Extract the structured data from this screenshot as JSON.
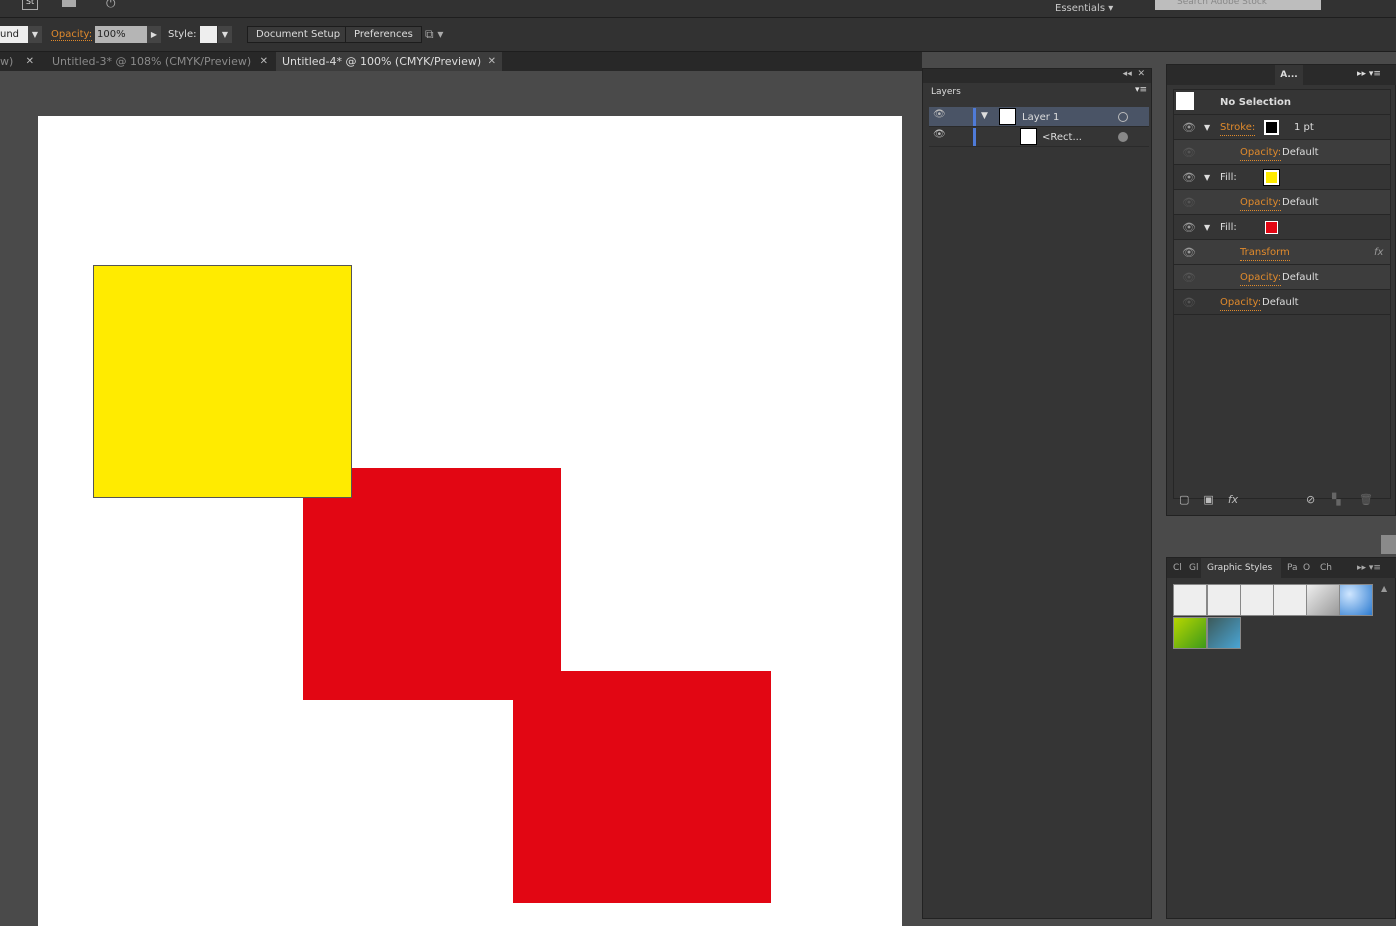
{
  "topbar": {
    "workspace": "Essentials",
    "search_placeholder": "Search Adobe Stock",
    "st_label": "St"
  },
  "control": {
    "partial_field": "und",
    "opacity_label": "Opacity:",
    "opacity_value": "100%",
    "style_label": "Style:",
    "document_setup": "Document Setup",
    "preferences": "Preferences"
  },
  "tabs": [
    {
      "label": "w)"
    },
    {
      "label": "Untitled-3* @ 108% (CMYK/Preview)"
    },
    {
      "label": "Untitled-4* @ 100% (CMYK/Preview)",
      "active": true
    }
  ],
  "canvas": {
    "colors": {
      "yellow": "#ffeb00",
      "red": "#e20613"
    }
  },
  "layers": {
    "tab": "Layers",
    "items": [
      {
        "name": "Layer 1"
      },
      {
        "name": "<Rect..."
      }
    ]
  },
  "appearance": {
    "tab": "A...",
    "title": "No Selection",
    "rows": [
      {
        "label": "Stroke:",
        "value": "1 pt"
      },
      {
        "label": "Opacity:",
        "value": "Default"
      },
      {
        "label": "Fill:",
        "swatch": "#ffeb00"
      },
      {
        "label": "Opacity:",
        "value": "Default"
      },
      {
        "label": "Fill:",
        "swatch": "#e20613"
      },
      {
        "label": "Transform",
        "value": "fx"
      },
      {
        "label": "Opacity:",
        "value": "Default"
      },
      {
        "label": "Opacity:",
        "value": "Default"
      }
    ],
    "footer_fx": "fx"
  },
  "graphic_styles": {
    "tabs": [
      "Cl",
      "Gl",
      "Graphic Styles",
      "Pa",
      "O",
      "Ch"
    ]
  }
}
